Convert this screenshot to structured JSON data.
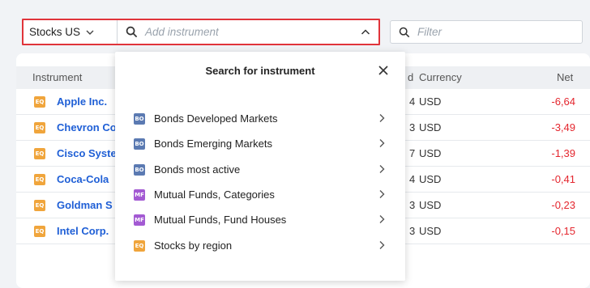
{
  "toolbar": {
    "market_select": "Stocks US",
    "search_placeholder": "Add instrument",
    "filter_placeholder": "Filter"
  },
  "table": {
    "columns": [
      "Instrument",
      "d",
      "Currency",
      "Net"
    ],
    "rows": [
      {
        "badge": "EQ",
        "name": "Apple Inc.",
        "partial": "4",
        "currency": "USD",
        "net": "-6,64"
      },
      {
        "badge": "EQ",
        "name": "Chevron Co",
        "partial": "3",
        "currency": "USD",
        "net": "-3,49"
      },
      {
        "badge": "EQ",
        "name": "Cisco Syste",
        "partial": "7",
        "currency": "USD",
        "net": "-1,39"
      },
      {
        "badge": "EQ",
        "name": "Coca-Cola",
        "partial": "4",
        "currency": "USD",
        "net": "-0,41"
      },
      {
        "badge": "EQ",
        "name": "Goldman S",
        "partial": "3",
        "currency": "USD",
        "net": "-0,23"
      },
      {
        "badge": "EQ",
        "name": "Intel Corp.",
        "partial": "3",
        "currency": "USD",
        "net": "-0,15"
      }
    ]
  },
  "popup": {
    "title": "Search for instrument",
    "items": [
      {
        "badge": "BO",
        "label": "Bonds Developed Markets"
      },
      {
        "badge": "BO",
        "label": "Bonds Emerging Markets"
      },
      {
        "badge": "BO",
        "label": "Bonds most active"
      },
      {
        "badge": "MF",
        "label": "Mutual Funds, Categories"
      },
      {
        "badge": "MF",
        "label": "Mutual Funds, Fund Houses"
      },
      {
        "badge": "EQ",
        "label": "Stocks by region"
      }
    ]
  },
  "colors": {
    "highlight_border": "#e0343a",
    "link": "#1f5fd6",
    "negative": "#e4262e",
    "badge_eq": "#f0a53c",
    "badge_bo": "#5b7ab2",
    "badge_mf": "#a35ad3"
  },
  "icons": [
    "search-icon",
    "chevron-down-icon",
    "chevron-up-icon",
    "close-icon",
    "chevron-right-icon"
  ]
}
